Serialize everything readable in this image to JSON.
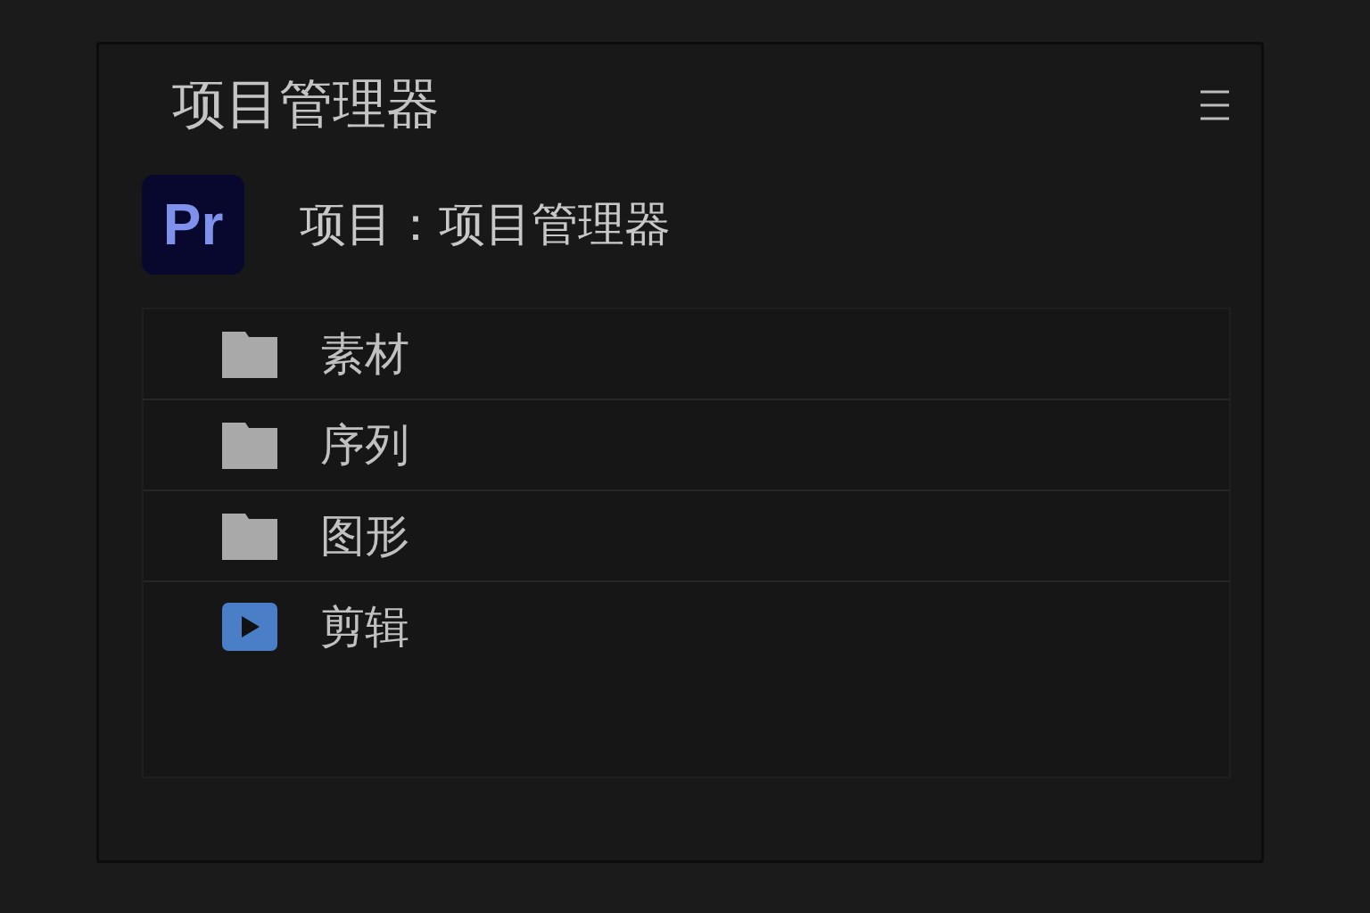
{
  "panel": {
    "title": "项目管理器"
  },
  "project": {
    "logo": "Pr",
    "label": "项目：项目管理器"
  },
  "items": [
    {
      "kind": "folder",
      "label": "素材"
    },
    {
      "kind": "folder",
      "label": "序列"
    },
    {
      "kind": "folder",
      "label": "图形"
    },
    {
      "kind": "sequence",
      "label": "剪辑"
    }
  ]
}
